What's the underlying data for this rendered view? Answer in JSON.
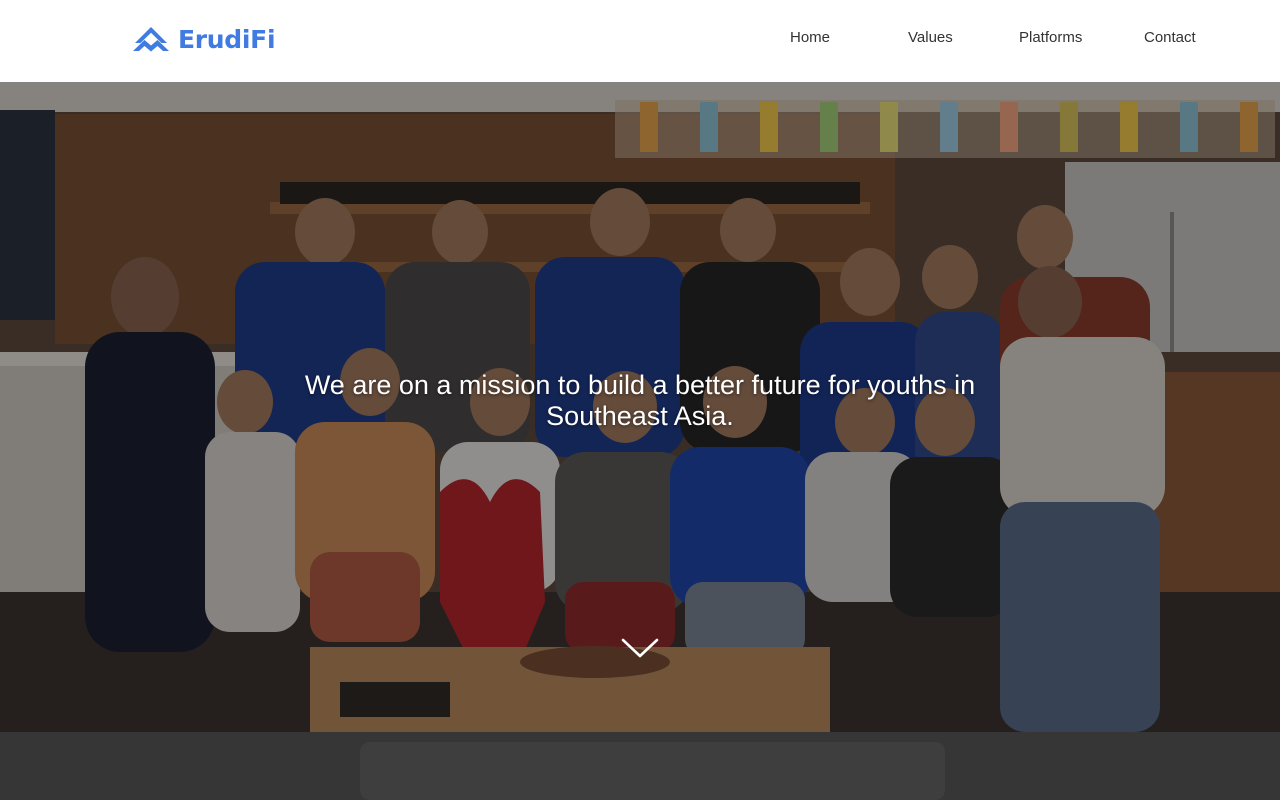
{
  "brand": {
    "name": "ErudiFi",
    "logo_icon": "mountain-logo-icon",
    "color": "#3f7be0"
  },
  "nav": {
    "items": [
      {
        "label": "Home"
      },
      {
        "label": "Values"
      },
      {
        "label": "Platforms"
      },
      {
        "label": "Contact"
      }
    ]
  },
  "hero": {
    "headline": "We are on a mission to build a better future for youths in Southeast Asia.",
    "image_subject": "team-group-photo",
    "scroll_icon": "chevron-down-icon"
  },
  "colors": {
    "header_bg": "#ffffff",
    "nav_text": "#333333",
    "hero_text": "#ffffff"
  }
}
